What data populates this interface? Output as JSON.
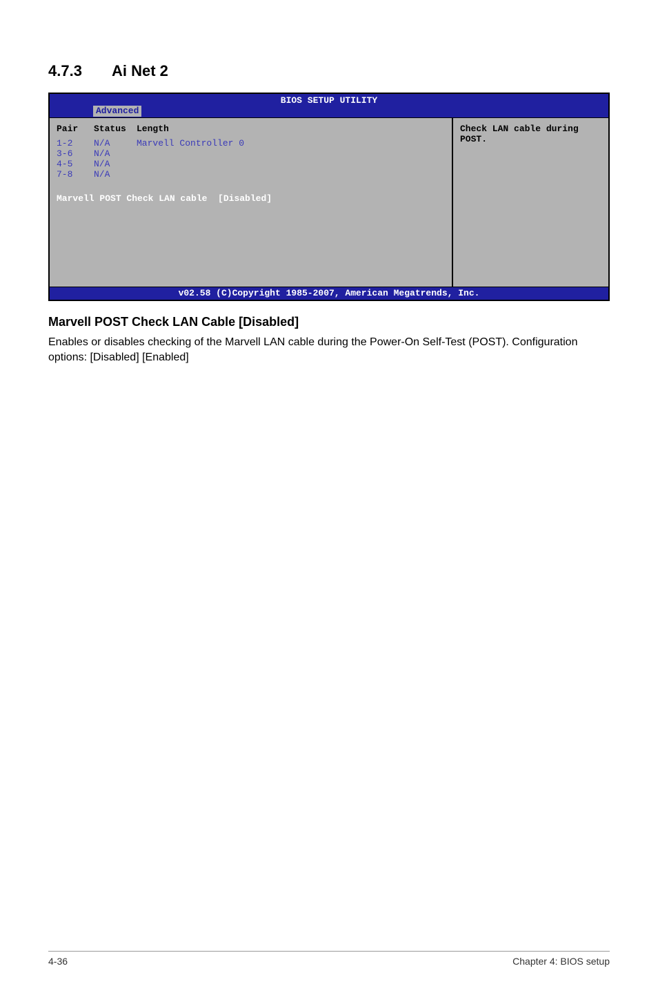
{
  "section": {
    "number": "4.7.3",
    "title": "Ai Net 2"
  },
  "bios": {
    "header_title": "BIOS SETUP UTILITY",
    "tab": "Advanced",
    "columns": {
      "pair": "Pair",
      "status": "Status",
      "length": "Length"
    },
    "controller_label": "Marvell Controller 0",
    "rows": [
      {
        "pair": "1-2",
        "status": "N/A"
      },
      {
        "pair": "3-6",
        "status": "N/A"
      },
      {
        "pair": "4-5",
        "status": "N/A"
      },
      {
        "pair": "7-8",
        "status": "N/A"
      }
    ],
    "action": {
      "label": "Marvell POST Check LAN cable",
      "value": "[Disabled]"
    },
    "help": "Check LAN cable during POST.",
    "footer": "v02.58 (C)Copyright 1985-2007, American Megatrends, Inc."
  },
  "subsection": {
    "title": "Marvell POST Check LAN Cable [Disabled]",
    "text": "Enables or disables checking of the Marvell LAN cable during the Power-On Self-Test (POST). Configuration options: [Disabled] [Enabled]"
  },
  "footer": {
    "left": "4-36",
    "right": "Chapter 4: BIOS setup"
  }
}
